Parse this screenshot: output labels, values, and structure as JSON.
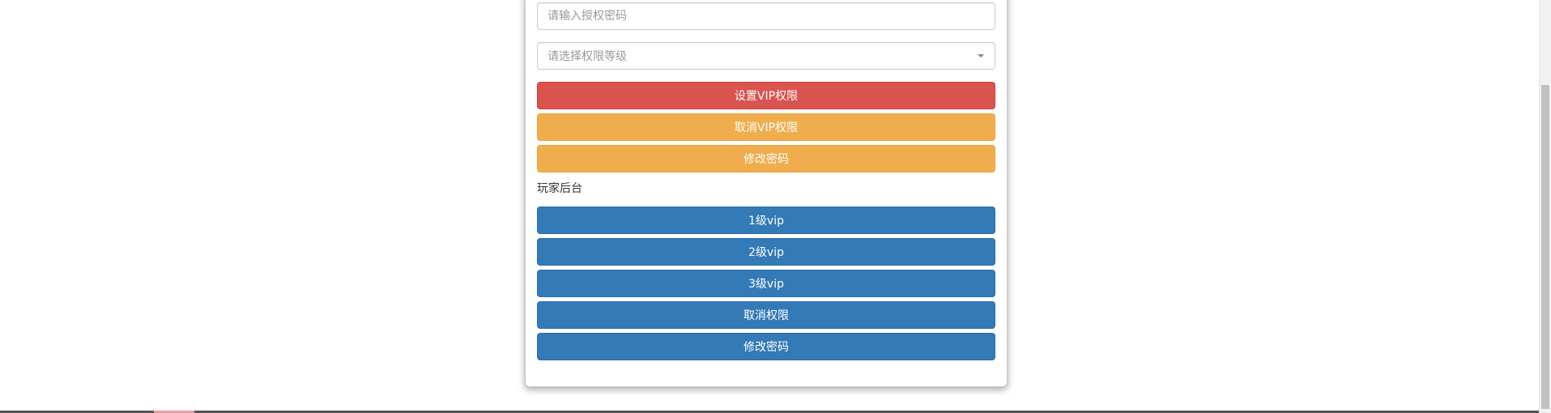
{
  "form": {
    "password_placeholder": "请输入授权密码",
    "level_select_placeholder": "请选择权限等级"
  },
  "admin_buttons": {
    "set_vip_label": "设置VIP权限",
    "cancel_vip_label": "取消VIP权限",
    "change_password_label": "修改密码"
  },
  "player_section": {
    "title": "玩家后台",
    "buttons": {
      "vip1_label": "1级vip",
      "vip2_label": "2级vip",
      "vip3_label": "3级vip",
      "cancel_permission_label": "取消权限",
      "change_password_label": "修改密码"
    }
  },
  "colors": {
    "danger": "#d9534f",
    "warning": "#f0ad4e",
    "primary": "#337ab7"
  },
  "icons": {
    "select_caret": "chevron-down-icon"
  }
}
